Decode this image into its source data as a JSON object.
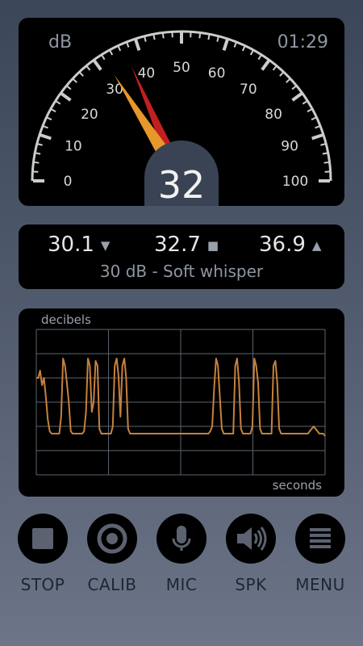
{
  "gauge": {
    "unit": "dB",
    "clock": "01:29",
    "value": 32,
    "peak": 36.9,
    "min_scale": 0,
    "max_scale": 100,
    "ticks": [
      "0",
      "10",
      "20",
      "30",
      "40",
      "50",
      "60",
      "70",
      "80",
      "90",
      "100"
    ],
    "colors": {
      "needle": "#e8982a",
      "peak_needle": "#c22020",
      "arc": "#cccccc"
    }
  },
  "readout": {
    "min": "30.1",
    "avg": "32.7",
    "max": "36.9",
    "description": "30 dB - Soft whisper"
  },
  "graph": {
    "y_label": "decibels",
    "x_label": "seconds",
    "line_color": "#c6813d",
    "series": [
      40,
      40,
      43,
      37,
      40,
      32,
      23,
      18,
      17,
      17,
      17,
      17,
      17,
      24,
      48,
      45,
      38,
      30,
      18,
      17,
      17,
      17,
      17,
      17,
      17,
      18,
      26,
      48,
      45,
      26,
      30,
      47,
      45,
      19,
      17,
      17,
      17,
      17,
      17,
      17,
      20,
      45,
      48,
      41,
      24,
      45,
      48,
      40,
      19,
      17,
      17,
      17,
      17,
      17,
      17,
      17,
      17,
      17,
      17,
      17,
      17,
      17,
      17,
      17,
      17,
      17,
      17,
      17,
      17,
      17,
      17,
      17,
      17,
      17,
      17,
      17,
      17,
      17,
      17,
      17,
      17,
      17,
      17,
      17,
      17,
      17,
      17,
      17,
      17,
      17,
      17,
      18,
      20,
      36,
      48,
      45,
      32,
      19,
      17,
      17,
      17,
      17,
      17,
      17,
      45,
      48,
      38,
      19,
      17,
      17,
      17,
      17,
      17,
      20,
      48,
      45,
      38,
      19,
      17,
      17,
      17,
      17,
      17,
      17,
      45,
      47,
      38,
      19,
      17,
      17,
      17,
      17,
      17,
      17,
      17,
      17,
      17,
      17,
      17,
      17,
      17,
      17,
      17,
      18,
      19,
      20,
      19,
      18,
      17,
      17,
      17,
      16
    ]
  },
  "controls": [
    {
      "label": "STOP",
      "icon": "stop-icon"
    },
    {
      "label": "CALIB",
      "icon": "calib-icon"
    },
    {
      "label": "MIC",
      "icon": "mic-icon"
    },
    {
      "label": "SPK",
      "icon": "speaker-icon"
    },
    {
      "label": "MENU",
      "icon": "menu-icon"
    }
  ]
}
